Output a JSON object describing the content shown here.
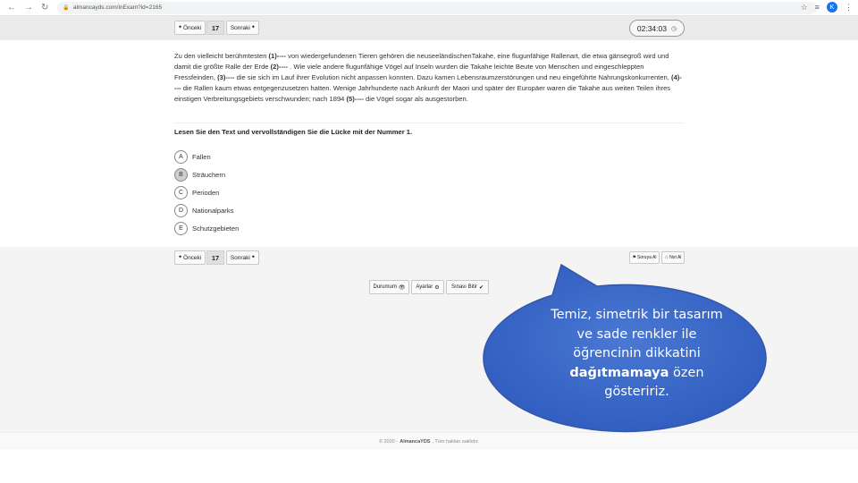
{
  "browser": {
    "url": "almancayds.com/inExam?id=2165",
    "profile_initial": "K"
  },
  "exam": {
    "prev_label": "Önceki",
    "next_label": "Sonraki",
    "question_number": "17",
    "timer": "02:34:03"
  },
  "passage": {
    "segments": [
      {
        "text": "Zu den vielleicht berühmtesten ",
        "bold": false
      },
      {
        "text": "(1)----",
        "bold": true
      },
      {
        "text": " von wiedergefundenen Tieren gehören die neuseeländischenTakahe, eine flugunfähige Rallenart, die etwa gänsegroß wird und damit die größte Ralle der Erde ",
        "bold": false
      },
      {
        "text": "(2)----",
        "bold": true
      },
      {
        "text": " . Wie viele andere flugunfähige Vögel auf Inseln wurden die Takahe leichte Beute von Menschen und eingeschleppten Fressfeinden, ",
        "bold": false
      },
      {
        "text": "(3)----",
        "bold": true
      },
      {
        "text": " die sie sich im Lauf ihrer Evolution nicht anpassen konnten. Dazu kamen Lebensraumzerstörungen und neu eingeführte Nahrungskonkurrenten, ",
        "bold": false
      },
      {
        "text": "(4)----",
        "bold": true
      },
      {
        "text": " die Rallen kaum etwas entgegenzusetzen hatten. Wenige Jahrhunderte nach Ankunft der Maori und später der Europäer waren die Takahe aus weiten Teilen ihres einstigen Verbreitungsgebiets verschwunden; nach 1894 ",
        "bold": false
      },
      {
        "text": "(5)----",
        "bold": true
      },
      {
        "text": " die Vögel sogar als ausgestorben.",
        "bold": false
      }
    ]
  },
  "question": "Lesen Sie den Text und vervollständigen Sie die Lücke mit der Nummer 1.",
  "options": [
    {
      "letter": "A",
      "text": "Fallen",
      "selected": false
    },
    {
      "letter": "B",
      "text": "Sträuchern",
      "selected": true
    },
    {
      "letter": "C",
      "text": "Perioden",
      "selected": false
    },
    {
      "letter": "D",
      "text": "Nationalparks",
      "selected": false
    },
    {
      "letter": "E",
      "text": "Schutzgebieten",
      "selected": false
    }
  ],
  "bottom": {
    "report_label": "Soruya Al",
    "note_label": "Not Al",
    "status_label": "Durumum",
    "settings_label": "Ayarlar",
    "finish_label": "Sınavı Bitir"
  },
  "footer": {
    "prefix": "© 2020 -",
    "brand": "AlmancaYDS",
    "suffix": ", Tüm hakları saklıdır."
  },
  "bubble": {
    "line1": "Temiz, simetrik bir tasarım",
    "line2": "ve sade renkler ile",
    "line3": "öğrencinin dikkatini",
    "line4_bold": "dağıtmamaya",
    "line4_rest": " özen",
    "line5": "gösteririz.",
    "color": "#3a67c4"
  }
}
